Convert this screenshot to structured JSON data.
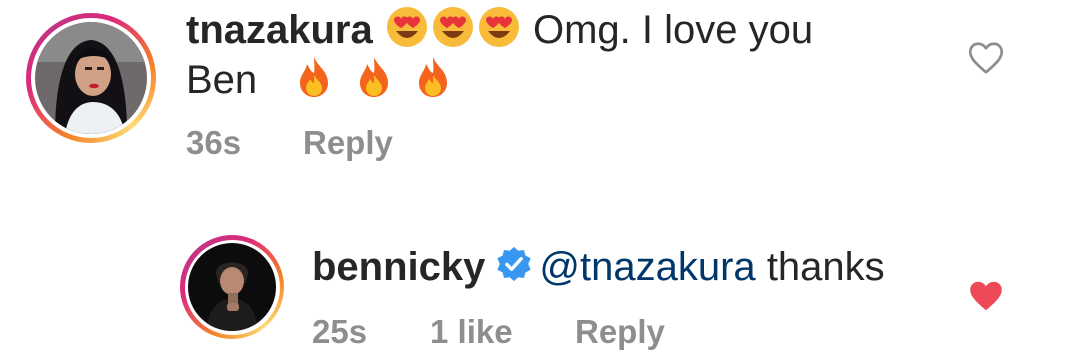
{
  "comments": [
    {
      "username": "tnazakura",
      "emoji_line1": [
        "heart-eyes-emoji",
        "heart-eyes-emoji",
        "heart-eyes-emoji"
      ],
      "text_line1": "Omg. I love you",
      "text_line2": "Ben",
      "emoji_line2": [
        "fire-emoji",
        "fire-emoji",
        "fire-emoji"
      ],
      "time": "36s",
      "reply_label": "Reply",
      "liked": false
    },
    {
      "username": "bennicky",
      "verified": true,
      "mention": "@tnazakura",
      "text": "thanks",
      "time": "25s",
      "likes": "1 like",
      "reply_label": "Reply",
      "liked": true
    }
  ],
  "colors": {
    "text": "#262626",
    "meta": "#8e8e8e",
    "mention": "#00376b",
    "like_red": "#ed4956",
    "verified_blue": "#3897f0"
  }
}
